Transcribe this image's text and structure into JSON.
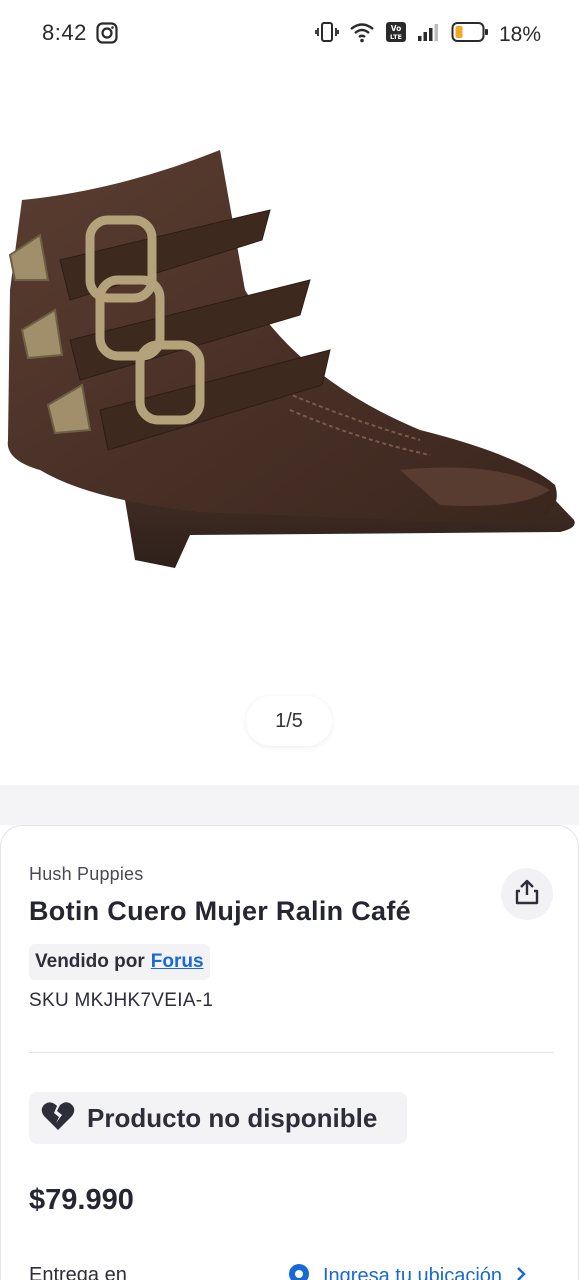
{
  "status_bar": {
    "time": "8:42",
    "battery": "18%"
  },
  "gallery": {
    "pager": "1/5"
  },
  "product": {
    "brand": "Hush Puppies",
    "title": "Botin Cuero Mujer Ralin Café",
    "sold_by_label": "Vendido por",
    "seller": "Forus",
    "sku": "SKU MKJHK7VEIA-1",
    "availability": "Producto no disponible",
    "price": "$79.990"
  },
  "delivery": {
    "label": "Entrega en",
    "location_link": "Ingresa tu ubicación"
  },
  "colors": {
    "link": "#1868d6",
    "battery_low": "#f5a623",
    "boot": "#4a3127"
  }
}
